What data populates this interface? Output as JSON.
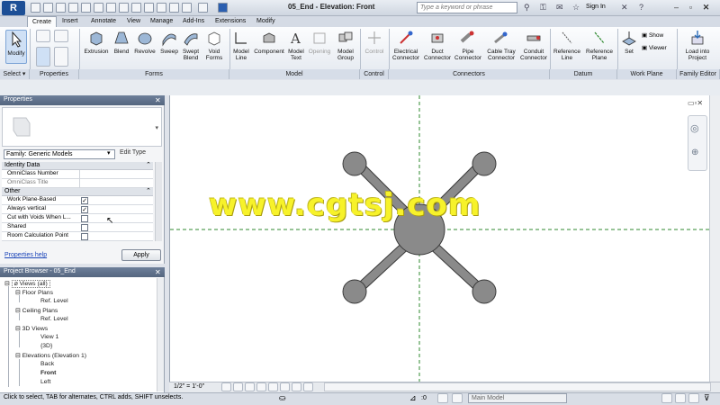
{
  "titlebar": {
    "app_letter": "R",
    "title": "05_End - Elevation: Front",
    "search_placeholder": "Type a keyword or phrase",
    "sign_in": "Sign In",
    "help": "?"
  },
  "tabs": [
    "Create",
    "Insert",
    "Annotate",
    "View",
    "Manage",
    "Add-Ins",
    "Extensions",
    "Modify"
  ],
  "ribbon": {
    "tools": {
      "modify": "Modify",
      "extrusion": "Extrusion",
      "blend": "Blend",
      "revolve": "Revolve",
      "sweep": "Sweep",
      "swept_blend": "Swept Blend",
      "void_forms": "Void Forms",
      "model_line": "Model Line",
      "component": "Component",
      "model_text": "Model Text",
      "opening": "Opening",
      "model_group": "Model Group",
      "control": "Control",
      "electrical_connector": "Electrical Connector",
      "duct_connector": "Duct Connector",
      "pipe_connector": "Pipe Connector",
      "cable_tray_connector": "Cable Tray Connector",
      "conduit_connector": "Conduit Connector",
      "reference_line": "Reference Line",
      "reference_plane": "Reference Plane",
      "set": "Set",
      "show": "Show",
      "viewer": "Viewer",
      "load_into_project": "Load into Project"
    },
    "panels": {
      "select": "Select ▾",
      "properties": "Properties",
      "forms": "Forms",
      "model": "Model",
      "control": "Control",
      "connectors": "Connectors",
      "datum": "Datum",
      "work_plane": "Work Plane",
      "family_editor": "Family Editor"
    }
  },
  "properties": {
    "header": "Properties",
    "family": "Family: Generic Models",
    "edit_type": "Edit Type",
    "groups": {
      "identity": "Identity Data",
      "other": "Other"
    },
    "rows": {
      "omniclass_number": "OmniClass Number",
      "omniclass_title": "OmniClass Title",
      "work_plane_based": "Work Plane-Based",
      "always_vertical": "Always vertical",
      "cut_with_voids": "Cut with Voids When L...",
      "shared": "Shared",
      "room_calc_point": "Room Calculation Point"
    },
    "help_link": "Properties help",
    "apply": "Apply"
  },
  "project_browser": {
    "header": "Project Browser - 05_End",
    "views_all": "Views (all)",
    "floor_plans": "Floor Plans",
    "ref_level_1": "Ref. Level",
    "ceiling_plans": "Ceiling Plans",
    "ref_level_2": "Ref. Level",
    "views_3d": "3D Views",
    "view_1": "View 1",
    "view_3d": "{3D}",
    "elevations": "Elevations (Elevation 1)",
    "back": "Back",
    "front": "Front",
    "left": "Left"
  },
  "canvas": {
    "watermark": "www.cgtsj.com"
  },
  "view_control": {
    "scale": "1/2\" = 1'-0\""
  },
  "statusbar": {
    "hint": "Click to select, TAB for alternates, CTRL adds, SHIFT unselects.",
    "zero": ":0",
    "model": "Main Model"
  },
  "colors": {
    "object_fill": "#8a8a8a",
    "object_stroke": "#3a3a3a",
    "ref_plane": "#2f8a2f",
    "watermark": "#f7f22a"
  }
}
